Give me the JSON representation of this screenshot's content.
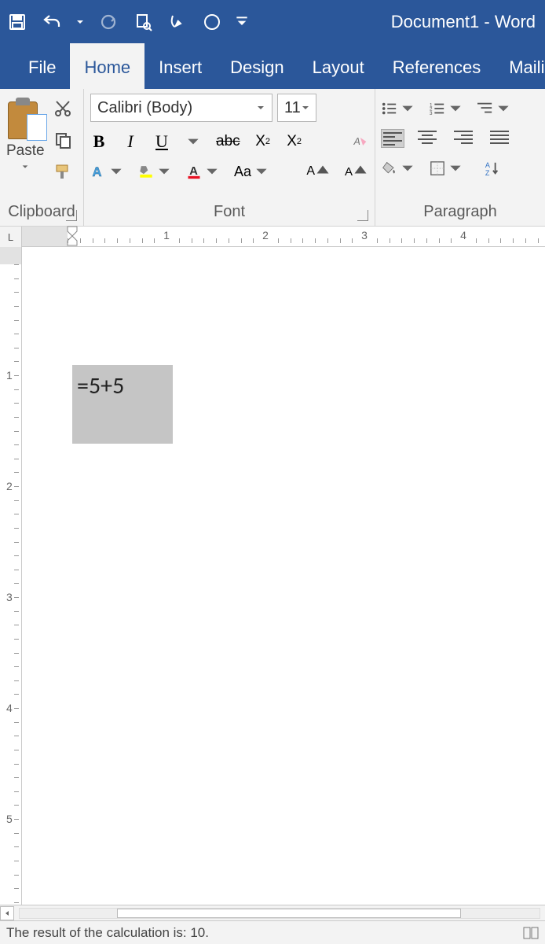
{
  "title": "Document1 - Word",
  "tabs": {
    "file": "File",
    "home": "Home",
    "insert": "Insert",
    "design": "Design",
    "layout": "Layout",
    "references": "References",
    "mailings": "Mailing"
  },
  "ribbon": {
    "clipboard": {
      "label": "Clipboard",
      "paste": "Paste"
    },
    "font": {
      "label": "Font",
      "name": "Calibri (Body)",
      "size": "11"
    },
    "paragraph": {
      "label": "Paragraph"
    }
  },
  "ruler": {
    "corner": "L",
    "numbers": [
      "1",
      "2",
      "3",
      "4"
    ]
  },
  "vruler": {
    "numbers": [
      "1",
      "2",
      "3",
      "4",
      "5"
    ]
  },
  "document": {
    "formula": "=5+5"
  },
  "status": {
    "message": "The result of the calculation is: 10."
  }
}
